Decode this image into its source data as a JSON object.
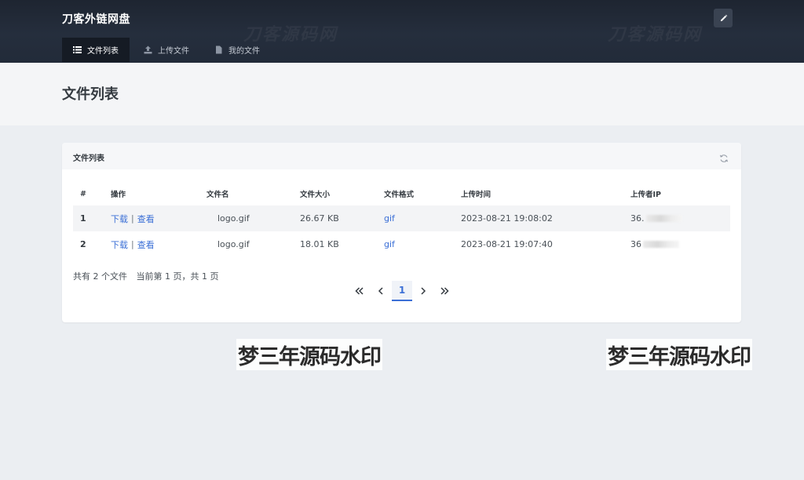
{
  "app": {
    "brand": "刀客外链网盘",
    "nav": [
      {
        "label": "文件列表",
        "icon": "list-icon",
        "active": true
      },
      {
        "label": "上传文件",
        "icon": "upload-icon",
        "active": false
      },
      {
        "label": "我的文件",
        "icon": "file-icon",
        "active": false
      }
    ],
    "edit_icon": "pencil-icon"
  },
  "page": {
    "title": "文件列表"
  },
  "card": {
    "title": "文件列表",
    "refresh_icon": "refresh-icon",
    "columns": [
      "#",
      "操作",
      "文件名",
      "文件大小",
      "文件格式",
      "上传时间",
      "上传者IP"
    ],
    "rows": [
      {
        "index": "1",
        "download": "下载",
        "sep": "|",
        "view": "查看",
        "name": "logo.gif",
        "size": "26.67 KB",
        "format": "gif",
        "time": "2023-08-21 19:08:02",
        "ip": "36."
      },
      {
        "index": "2",
        "download": "下载",
        "sep": "|",
        "view": "查看",
        "name": "logo.gif",
        "size": "18.01 KB",
        "format": "gif",
        "time": "2023-08-21 19:07:40",
        "ip": "36"
      }
    ],
    "summary": {
      "count": "共有 2 个文件",
      "page": "当前第 1 页，共 1 页"
    },
    "pager": {
      "first": "«",
      "prev": "‹",
      "current": "1",
      "next": "›",
      "last": "»"
    }
  },
  "watermarks": {
    "dark": "刀客源码网",
    "light": "梦三年源码水印"
  },
  "colors": {
    "header": "#222b39",
    "link": "#3b6fd6",
    "background": "#ebeef2"
  }
}
